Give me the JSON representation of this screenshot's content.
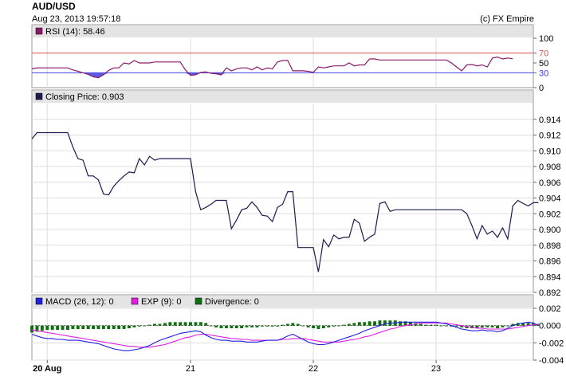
{
  "header": {
    "symbol": "AUD/USD",
    "timestamp": "Aug 23, 2013 19:57:18",
    "credit": "(c) FX Empire"
  },
  "chart_data": [
    {
      "type": "line",
      "panel": "rsi",
      "legend": "RSI (14): 58.46",
      "color": "#8b1a6b",
      "ylim": [
        0,
        100
      ],
      "y_ticks": [
        "0",
        "30",
        "50",
        "70",
        "100"
      ],
      "overbought": 70,
      "oversold": 30,
      "overbought_color": "#e05050",
      "oversold_color": "#4040e0",
      "values": [
        38,
        40,
        40,
        40,
        40,
        40,
        40,
        40,
        36,
        33,
        30,
        27,
        22,
        20,
        26,
        35,
        40,
        40,
        50,
        48,
        55,
        50,
        50,
        50,
        52,
        52,
        52,
        52,
        52,
        52,
        36,
        25,
        26,
        31,
        32,
        29,
        28,
        26,
        40,
        34,
        38,
        40,
        40,
        36,
        42,
        36,
        40,
        38,
        52,
        55,
        55,
        34,
        34,
        34,
        33,
        31,
        42,
        40,
        42,
        44,
        44,
        44,
        50,
        44,
        46,
        46,
        58,
        58,
        56,
        56,
        56,
        56,
        56,
        56,
        56,
        56,
        56,
        56,
        56,
        56,
        56,
        56,
        50,
        42,
        34,
        46,
        47,
        44,
        46,
        42,
        60,
        62,
        58,
        60,
        58.46
      ]
    },
    {
      "type": "line",
      "panel": "price",
      "legend": "Closing Price: 0.903",
      "color": "#1c1c4e",
      "ylim": [
        0.892,
        0.916
      ],
      "y_ticks": [
        "0.892",
        "0.894",
        "0.896",
        "0.898",
        "0.900",
        "0.902",
        "0.904",
        "0.906",
        "0.908",
        "0.910",
        "0.912",
        "0.914"
      ],
      "values": [
        0.9115,
        0.9123,
        0.9123,
        0.9123,
        0.9123,
        0.9123,
        0.9123,
        0.9123,
        0.9105,
        0.909,
        0.9088,
        0.9068,
        0.9068,
        0.9063,
        0.9045,
        0.9044,
        0.9055,
        0.9062,
        0.9068,
        0.9073,
        0.9072,
        0.909,
        0.9082,
        0.9093,
        0.9088,
        0.909,
        0.909,
        0.909,
        0.909,
        0.909,
        0.909,
        0.909,
        0.9048,
        0.9025,
        0.9028,
        0.9032,
        0.9037,
        0.9037,
        0.9037,
        0.9001,
        0.9012,
        0.9025,
        0.9027,
        0.9035,
        0.9028,
        0.9018,
        0.9017,
        0.901,
        0.9028,
        0.9032,
        0.9048,
        0.9048,
        0.8977,
        0.8977,
        0.8977,
        0.8977,
        0.8946,
        0.8987,
        0.8978,
        0.8993,
        0.8988,
        0.899,
        0.899,
        0.9013,
        0.9008,
        0.8985,
        0.899,
        0.8994,
        0.9033,
        0.9035,
        0.9023,
        0.9025,
        0.9025,
        0.9025,
        0.9025,
        0.9025,
        0.9025,
        0.9025,
        0.9025,
        0.9025,
        0.9025,
        0.9025,
        0.9025,
        0.9025,
        0.9025,
        0.902,
        0.9005,
        0.8988,
        0.9005,
        0.8994,
        0.8998,
        0.899,
        0.9002,
        0.8988,
        0.903,
        0.9037,
        0.9033,
        0.903,
        0.9034,
        0.9034
      ]
    },
    {
      "type": "line",
      "panel": "macd",
      "legend": [
        {
          "label": "MACD (26, 12): 0",
          "color": "#2020e0"
        },
        {
          "label": "EXP (9): 0",
          "color": "#e020e0"
        },
        {
          "label": "Divergence: 0",
          "color": "#107010"
        }
      ],
      "ylim": [
        -0.004,
        0.002
      ],
      "y_ticks": [
        "-0.004",
        "-0.002",
        "0.000",
        "0.002"
      ],
      "series": [
        {
          "name": "MACD (26, 12)",
          "color": "#2020e0",
          "values": [
            -0.001,
            -0.0012,
            -0.0014,
            -0.0015,
            -0.0015,
            -0.0016,
            -0.0016,
            -0.0017,
            -0.0017,
            -0.0017,
            -0.0018,
            -0.0019,
            -0.002,
            -0.0021,
            -0.0023,
            -0.0025,
            -0.0027,
            -0.0028,
            -0.0029,
            -0.0029,
            -0.0028,
            -0.0027,
            -0.0025,
            -0.0023,
            -0.002,
            -0.0017,
            -0.0015,
            -0.0013,
            -0.0011,
            -0.0009,
            -0.0008,
            -0.0007,
            -0.0006,
            -0.0007,
            -0.0011,
            -0.0014,
            -0.0016,
            -0.0017,
            -0.0017,
            -0.0018,
            -0.0018,
            -0.0018,
            -0.0019,
            -0.0019,
            -0.0019,
            -0.0018,
            -0.0017,
            -0.0017,
            -0.0017,
            -0.0015,
            -0.0012,
            -0.001,
            -0.0013,
            -0.0016,
            -0.0019,
            -0.0021,
            -0.0022,
            -0.0022,
            -0.0021,
            -0.0019,
            -0.0017,
            -0.0015,
            -0.0013,
            -0.0011,
            -0.0009,
            -0.0006,
            -0.0004,
            -0.0002,
            0.0,
            0.0002,
            0.0003,
            0.0003,
            0.0004,
            0.0004,
            0.0004,
            0.0004,
            0.0004,
            0.0004,
            0.0004,
            0.0004,
            0.0003,
            0.0002,
            0.0,
            -0.0002,
            -0.0004,
            -0.0005,
            -0.0006,
            -0.0006,
            -0.0005,
            -0.0006,
            -0.0006,
            -0.0007,
            -0.0006,
            -0.0003,
            0.0,
            0.0002,
            0.0003,
            0.0004,
            0.0003,
            0.0
          ]
        },
        {
          "name": "EXP (9)",
          "color": "#e020e0",
          "values": [
            -0.0005,
            -0.0006,
            -0.0007,
            -0.0008,
            -0.0009,
            -0.001,
            -0.0011,
            -0.0012,
            -0.0013,
            -0.0014,
            -0.0015,
            -0.0016,
            -0.0017,
            -0.0018,
            -0.0019,
            -0.002,
            -0.0021,
            -0.0022,
            -0.0023,
            -0.0024,
            -0.0024,
            -0.0025,
            -0.0025,
            -0.0025,
            -0.0024,
            -0.0023,
            -0.0022,
            -0.002,
            -0.0018,
            -0.0016,
            -0.0014,
            -0.0013,
            -0.0011,
            -0.001,
            -0.001,
            -0.0011,
            -0.0012,
            -0.0013,
            -0.0014,
            -0.0015,
            -0.0015,
            -0.0016,
            -0.0016,
            -0.0017,
            -0.0017,
            -0.0017,
            -0.0017,
            -0.0017,
            -0.0017,
            -0.0016,
            -0.0016,
            -0.0015,
            -0.0015,
            -0.0015,
            -0.0016,
            -0.0017,
            -0.0018,
            -0.0019,
            -0.0019,
            -0.0019,
            -0.0019,
            -0.0018,
            -0.0017,
            -0.0016,
            -0.0015,
            -0.0013,
            -0.0012,
            -0.001,
            -0.0008,
            -0.0006,
            -0.0004,
            -0.0003,
            -0.0001,
            0.0,
            0.0001,
            0.0002,
            0.0003,
            0.0003,
            0.0003,
            0.0003,
            0.0003,
            0.0003,
            0.0002,
            0.0001,
            0.0,
            -0.0001,
            -0.0002,
            -0.0003,
            -0.0003,
            -0.0004,
            -0.0004,
            -0.0004,
            -0.0004,
            -0.0004,
            -0.0003,
            -0.0002,
            -0.0001,
            0.0,
            0.0001,
            0.0001
          ]
        },
        {
          "name": "Divergence",
          "color": "#107010",
          "type": "bar",
          "values": [
            -0.0008,
            -0.0007,
            -0.0006,
            -0.0005,
            -0.0005,
            -0.0005,
            -0.0005,
            -0.0005,
            -0.0004,
            -0.0004,
            -0.0004,
            -0.0004,
            -0.0004,
            -0.0004,
            -0.0004,
            -0.0004,
            -0.0004,
            -0.0004,
            -0.0004,
            -0.0003,
            -0.0002,
            -0.0001,
            0.0,
            0.0001,
            0.0002,
            0.0002,
            0.0003,
            0.0004,
            0.0004,
            0.0004,
            0.0004,
            0.0004,
            0.0004,
            0.0004,
            0.0003,
            0.0,
            -0.0002,
            -0.0003,
            -0.0003,
            -0.0003,
            -0.0003,
            -0.0003,
            -0.0002,
            -0.0002,
            -0.0002,
            -0.0001,
            -0.0001,
            -0.0001,
            -0.0001,
            0.0001,
            0.0002,
            0.0003,
            0.0002,
            0.0,
            -0.0002,
            -0.0003,
            -0.0004,
            -0.0003,
            -0.0002,
            -0.0001,
            0.0,
            0.0001,
            0.0002,
            0.0003,
            0.0004,
            0.0004,
            0.0005,
            0.0005,
            0.0006,
            0.0006,
            0.0006,
            0.0006,
            0.0005,
            0.0005,
            0.0004,
            0.0003,
            0.0002,
            0.0001,
            0.0001,
            0.0001,
            0.0,
            0.0,
            -0.0001,
            -0.0001,
            -0.0002,
            -0.0003,
            -0.0003,
            -0.0003,
            -0.0002,
            -0.0002,
            -0.0002,
            -0.0003,
            -0.0002,
            0.0,
            0.0002,
            0.0003,
            0.0003,
            0.0003,
            0.0003,
            0.0002
          ]
        }
      ]
    }
  ],
  "x_axis": {
    "labels": [
      {
        "label": "20 Aug",
        "index": 3,
        "bold": true
      },
      {
        "label": "21",
        "index": 31
      },
      {
        "label": "22",
        "index": 55
      },
      {
        "label": "23",
        "index": 79
      }
    ],
    "count": 99
  }
}
